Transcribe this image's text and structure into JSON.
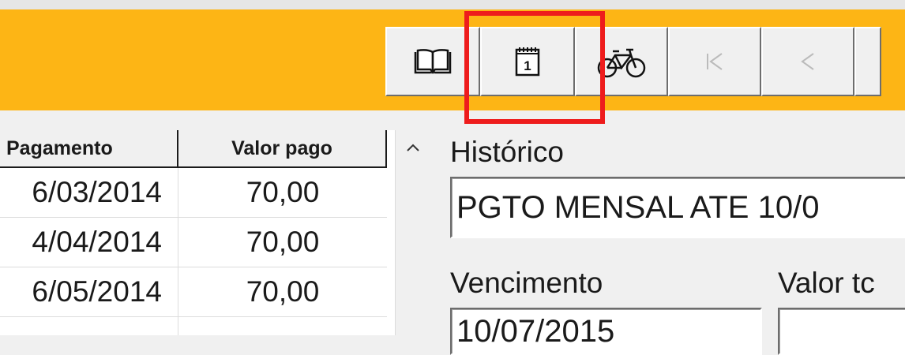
{
  "toolbar": {
    "icons": [
      "open-book-icon",
      "calendar-icon",
      "bicycle-icon",
      "first-record-icon",
      "previous-record-icon"
    ],
    "calendar_digit": "1"
  },
  "colors": {
    "toolbar_background": "#fdb515",
    "highlight": "#ee1c1c",
    "window": "#f0f0f0"
  },
  "grid": {
    "columns": [
      "Pagamento",
      "Valor pago"
    ],
    "rows": [
      {
        "pagamento": "6/03/2014",
        "valor": "70,00"
      },
      {
        "pagamento": "4/04/2014",
        "valor": "70,00"
      },
      {
        "pagamento": "6/05/2014",
        "valor": "70,00"
      }
    ]
  },
  "form": {
    "historico_label": "Histórico",
    "historico_value": "PGTO MENSAL ATE 10/0",
    "vencimento_label": "Vencimento",
    "vencimento_value": "10/07/2015",
    "valor_total_label": "Valor tc"
  }
}
